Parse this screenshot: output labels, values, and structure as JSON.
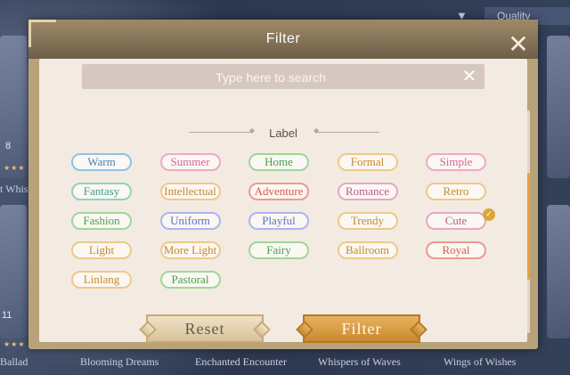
{
  "background": {
    "quality_label": "Quality",
    "side_caption": "t Whisp",
    "side_num_top": "8",
    "side_num_bottom": "11",
    "captions": [
      "Ballad",
      "Blooming Dreams",
      "Enchanted Encounter",
      "Whispers of Waves",
      "Wings of Wishes"
    ]
  },
  "dialog": {
    "title": "Filter",
    "search": {
      "placeholder": "Type here to search",
      "value": ""
    },
    "section_label": "Label",
    "tags": [
      {
        "label": "Warm",
        "color": "blue",
        "selected": false
      },
      {
        "label": "Summer",
        "color": "pink",
        "selected": false
      },
      {
        "label": "Home",
        "color": "green",
        "selected": false
      },
      {
        "label": "Formal",
        "color": "orange",
        "selected": false
      },
      {
        "label": "Simple",
        "color": "pink",
        "selected": false
      },
      {
        "label": "Fantasy",
        "color": "teal",
        "selected": false
      },
      {
        "label": "Intellectual",
        "color": "orange",
        "selected": false
      },
      {
        "label": "Adventure",
        "color": "red",
        "selected": false
      },
      {
        "label": "Romance",
        "color": "rose",
        "selected": false
      },
      {
        "label": "Retro",
        "color": "orange",
        "selected": false
      },
      {
        "label": "Fashion",
        "color": "green",
        "selected": false
      },
      {
        "label": "Uniform",
        "color": "indigo",
        "selected": false
      },
      {
        "label": "Playful",
        "color": "indigo",
        "selected": false
      },
      {
        "label": "Trendy",
        "color": "orange",
        "selected": false
      },
      {
        "label": "Cute",
        "color": "rose",
        "selected": true
      },
      {
        "label": "Light",
        "color": "orange",
        "selected": false
      },
      {
        "label": "More Light",
        "color": "orange",
        "selected": false
      },
      {
        "label": "Fairy",
        "color": "green",
        "selected": false
      },
      {
        "label": "Ballroom",
        "color": "orange",
        "selected": false
      },
      {
        "label": "Royal",
        "color": "red",
        "selected": false
      },
      {
        "label": "Linlang",
        "color": "orange",
        "selected": false
      },
      {
        "label": "Pastoral",
        "color": "green",
        "selected": false
      }
    ],
    "reset_label": "Reset",
    "filter_label": "Filter"
  },
  "colors": {
    "accent": "#e8a23c",
    "selected_check": "#d9a63a"
  }
}
